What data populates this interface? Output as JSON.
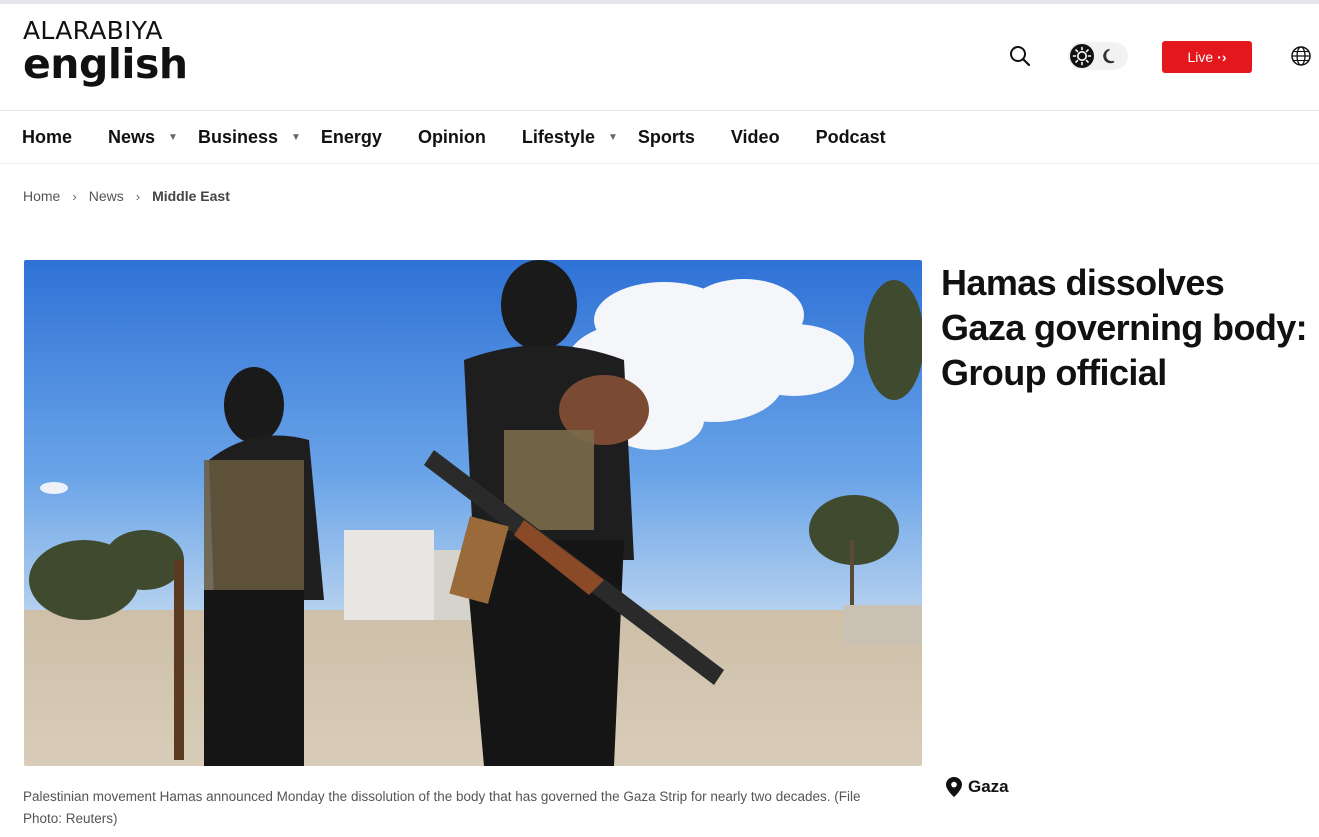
{
  "logo": {
    "line1": "ALARABIYA",
    "line2": "english"
  },
  "header": {
    "live_label": "Live",
    "live_color": "#e3171c",
    "icons": [
      "search-icon",
      "sun-icon",
      "moon-icon",
      "globe-icon"
    ]
  },
  "nav": {
    "items": [
      {
        "label": "Home",
        "has_dropdown": false
      },
      {
        "label": "News",
        "has_dropdown": true
      },
      {
        "label": "Business",
        "has_dropdown": true
      },
      {
        "label": "Energy",
        "has_dropdown": false
      },
      {
        "label": "Opinion",
        "has_dropdown": false
      },
      {
        "label": "Lifestyle",
        "has_dropdown": true
      },
      {
        "label": "Sports",
        "has_dropdown": false
      },
      {
        "label": "Video",
        "has_dropdown": false
      },
      {
        "label": "Podcast",
        "has_dropdown": false
      }
    ]
  },
  "breadcrumb": {
    "items": [
      "Home",
      "News",
      "Middle East"
    ]
  },
  "article": {
    "headline": "Hamas dissolves Gaza governing body: Group official",
    "caption": "Palestinian movement Hamas announced Monday the dissolution of the body that has governed the Gaza Strip for nearly two decades. (File Photo: Reuters)",
    "location": "Gaza"
  }
}
